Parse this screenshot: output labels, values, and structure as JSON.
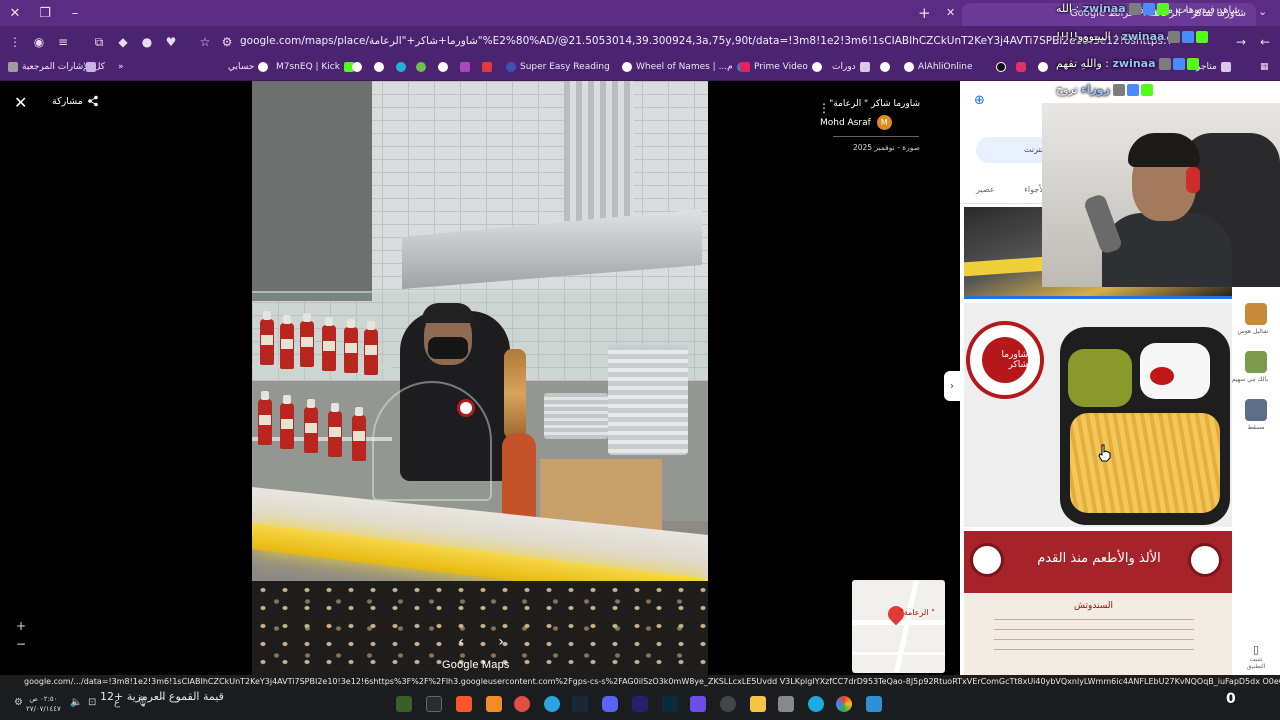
{
  "browser": {
    "active_tab_title": "شاورما شاكر \" الرعامة\" - خرائط Google",
    "other_tab_title": "شاهد فيديوهات مشهورة",
    "url": "google.com/maps/place/شاورما+شاكر+\"الرعامة\"%E2%80%AD/@21.5053014,39.300924,3a,75y,90t/data=!3m8!1e2!3m6!1sCIABIhCZCkUnT2KeY3j4AVTi7SPBI2e10!3e12!6shttps:%2F%2Flh3.googleusercontent.com%2Fgps-cs-s",
    "status_url": "google.com/.../data=!3m8!1e2!3m6!1sCIABIhCZCkUnT2KeY3j4AVTi7SPBI2e10!3e12!6shttps%3F%2F%2Flh3.googleusercontent.com%2Fgps-cs-s%2FAG0ilSzO3k0mW8ye_ZKSLLcxLE5Uvdd V3LKplgIYXzfCC7drD953TeQao-8J5p92RtuoRTxVErComGcTt8xUi40ybVQxnlyLWmm6ic4ANFLEbU27KvNQOqB_iuFapD5dx O0eOUrcOq5j6wcIPS8b%3Dw203-h270-k-no!7i244..."
  },
  "bookmarks": [
    {
      "label": "كل الإشارات المرجعية",
      "color": "#9e9e9e"
    },
    {
      "label": "",
      "color": "#7e57c2"
    },
    {
      "label": "حسابي",
      "color": "#4caf50"
    },
    {
      "label": "M7snEQ | Kick",
      "color": "#53fc18"
    },
    {
      "label": "",
      "color": "#4285f4"
    },
    {
      "label": "",
      "color": "#0f9d58"
    },
    {
      "label": "",
      "color": "#ab47bc"
    },
    {
      "label": "",
      "color": "#e91e63"
    },
    {
      "label": "Super Easy Reading",
      "color": "#3f51b5"
    },
    {
      "label": "Wheel of Names | ...م",
      "color": "#ff9800"
    },
    {
      "label": "Prime Video",
      "color": "#00a8e1"
    },
    {
      "label": "دورات",
      "color": "#f5f5f5"
    },
    {
      "label": "AlAhliOnline",
      "color": "#2e7d32"
    },
    {
      "label": "",
      "color": "#111111"
    },
    {
      "label": "",
      "color": "#e1306c"
    },
    {
      "label": "متاجر",
      "color": "#795548"
    }
  ],
  "viewer": {
    "share_label": "مشاركة",
    "place_title": "شاورما شاكر \" الرعامة\"",
    "author": "Mohd Asraf",
    "author_initial": "M",
    "date_label": "صورة - نوفمبر 2025",
    "watermark": "Google Maps",
    "minimap_label": "\" الرعامة\""
  },
  "side_panel": {
    "chip_label": "طلب على الإنترنت",
    "tabs": [
      "الأجواء",
      "عصير"
    ],
    "logo_text": "شاورما شاكر",
    "menu_slogan": "الألذ والأطعم منذ القدم",
    "menu_section": "السندوتش",
    "rail_items": [
      {
        "label": "شاليل هوس",
        "color": "#c98a3a"
      },
      {
        "label": "بالك بني سهيم",
        "color": "#7d9a4f"
      },
      {
        "label": "مسقط",
        "color": "#5b6f88"
      }
    ],
    "bottom_label": "تثبيت التطبيق"
  },
  "stream_overlay": {
    "lines": [
      {
        "brand": "zwinaa",
        "text": ": الله"
      },
      {
        "brand": "zwinaa",
        "text": ": البيبووو!!!!!"
      },
      {
        "brand": "zwinaa",
        "text": ": واللهِ تقهم"
      },
      {
        "brand": "زوزاء",
        "text": "تروح"
      }
    ]
  },
  "taskbar": {
    "time": "٠٢:٥٠ ص",
    "date": "٢٧/٠٧/١٤٤٧",
    "weather": "قيمة القموع العرمزية +12",
    "lang": "ع",
    "counter": "0"
  }
}
